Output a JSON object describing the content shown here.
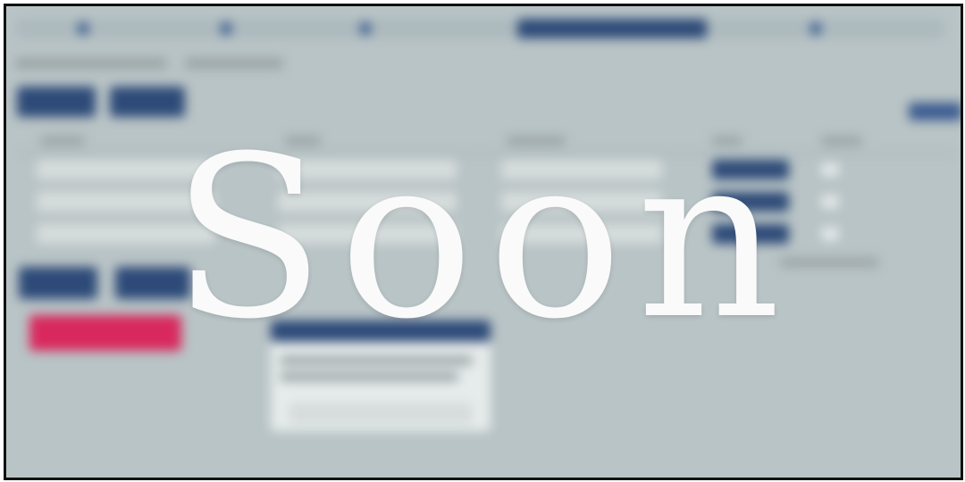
{
  "overlay": {
    "text": "Soon"
  },
  "colors": {
    "background": "#b9c4c6",
    "primary": "#2d4a78",
    "danger": "#d8285d",
    "frame": "#111111",
    "overlay_text": "#fafafa"
  }
}
